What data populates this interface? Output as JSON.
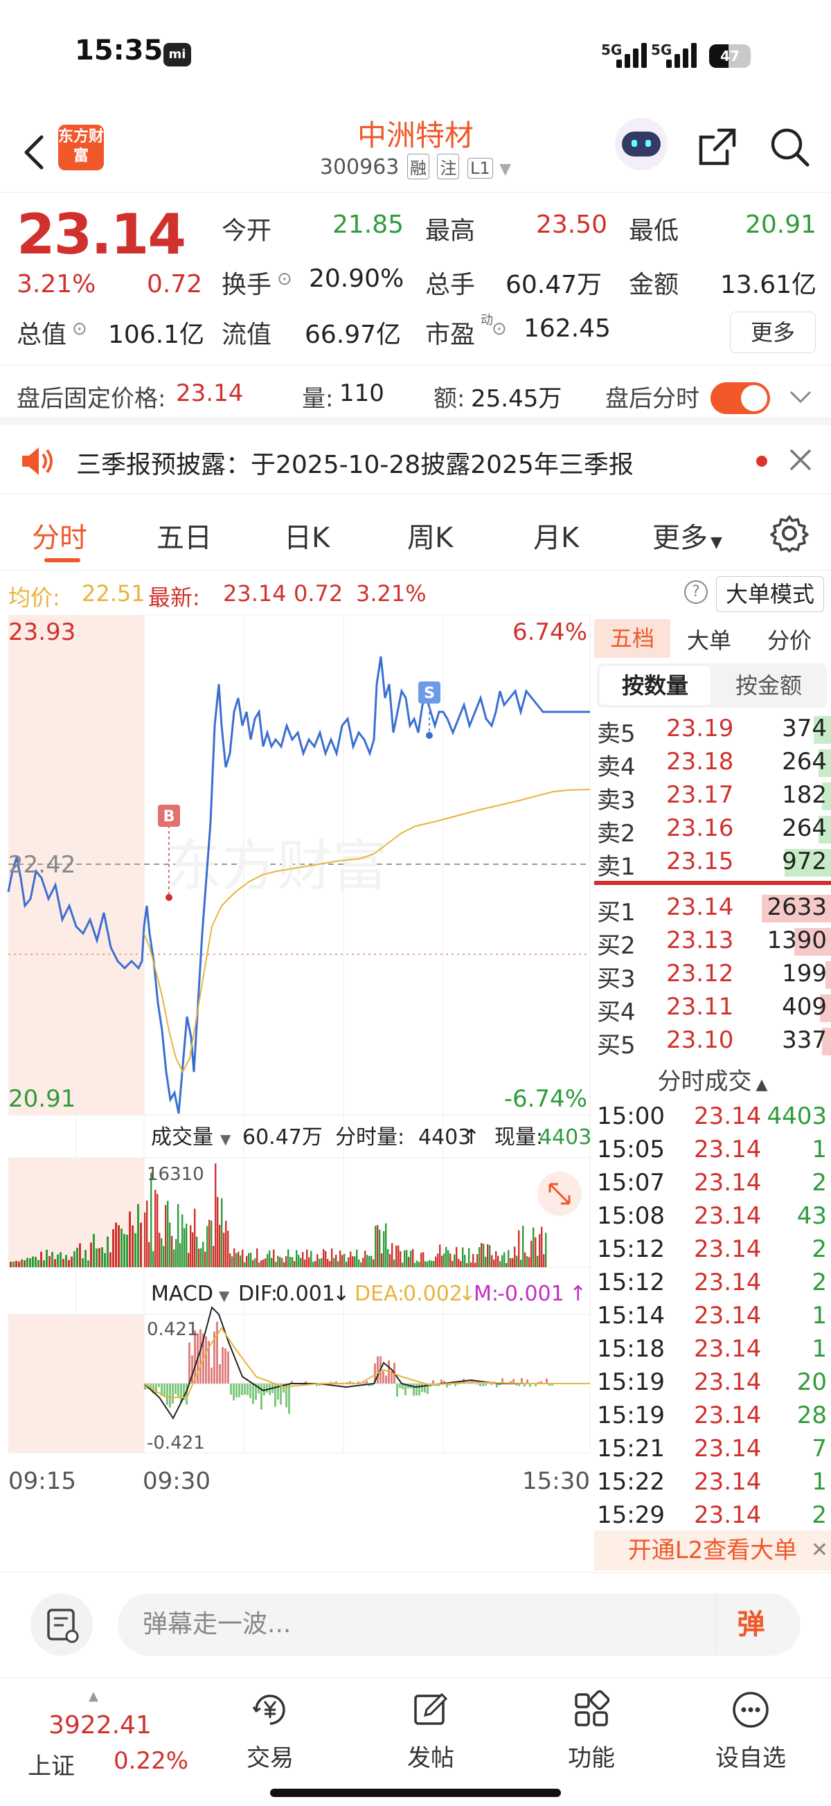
{
  "status_bar": {
    "time": "15:35",
    "signal1": "5G",
    "signal2": "5G",
    "battery": "47"
  },
  "header": {
    "logo": "东方财富",
    "stock_name": "中洲特材",
    "stock_code": "300963",
    "tags": [
      "融",
      "注",
      "L1"
    ]
  },
  "quote": {
    "price": "23.14",
    "pct": "3.21%",
    "change": "0.72",
    "fields": [
      {
        "label": "今开",
        "value": "21.85",
        "color": "#2e9c3a"
      },
      {
        "label": "最高",
        "value": "23.50",
        "color": "#d0312d"
      },
      {
        "label": "最低",
        "value": "20.91",
        "color": "#2e9c3a"
      },
      {
        "label": "换手",
        "value": "20.90%",
        "color": "#222222"
      },
      {
        "label": "总手",
        "value": "60.47万",
        "color": "#222222"
      },
      {
        "label": "金额",
        "value": "13.61亿",
        "color": "#222222"
      },
      {
        "label": "总值",
        "value": "106.1亿",
        "color": "#222222"
      },
      {
        "label": "流值",
        "value": "66.97亿",
        "color": "#222222"
      },
      {
        "label": "市盈",
        "value": "162.45",
        "color": "#222222"
      }
    ],
    "pe_sup": "动",
    "more_label": "更多"
  },
  "after_hours": {
    "fixed_label": "盘后固定价格:",
    "fixed_value": "23.14",
    "vol_label": "量:",
    "vol_value": "110",
    "amt_label": "额:",
    "amt_value": "25.45万",
    "timeshare_label": "盘后分时"
  },
  "notice": {
    "text": "三季报预披露：于2025-10-28披露2025年三季报"
  },
  "tabs": [
    "分时",
    "五日",
    "日K",
    "周K",
    "月K",
    "更多"
  ],
  "avg_row": {
    "avg_label": "均价:",
    "avg_value": "22.51",
    "latest_label": "最新:",
    "latest_value": "23.14",
    "change": "0.72",
    "pct": "3.21%",
    "mode_button": "大单模式"
  },
  "chart_labels": {
    "top_price": "23.93",
    "top_pct": "6.74%",
    "mid_price": "22.42",
    "bottom_price": "20.91",
    "bottom_pct": "-6.74%",
    "marker_b": "B",
    "marker_s": "S",
    "vol_title": "成交量",
    "vol_total": "60.47万",
    "timeshare_vol_label": "分时量:",
    "timeshare_vol": "4403",
    "now_vol_label": "现量:",
    "now_vol": "4403",
    "vol_max": "16310",
    "macd_title": "MACD",
    "dif_label": "DIF:",
    "dif": "0.001",
    "dea_label": "DEA:",
    "dea": "0.002",
    "m_label": "M:",
    "m": "-0.001",
    "macd_max": "0.421",
    "macd_min": "-0.421",
    "time_start": "09:15",
    "time_open": "09:30",
    "time_end": "15:30"
  },
  "chart_data": {
    "type": "line",
    "x_range": [
      "09:15",
      "15:30"
    ],
    "ylim": [
      20.91,
      23.93
    ],
    "pct_range": [
      "-6.74%",
      "6.74%"
    ],
    "reference": 22.42,
    "series": [
      {
        "name": "price",
        "x": [
          "09:15",
          "09:20",
          "09:25",
          "09:30",
          "09:32",
          "09:35",
          "09:40",
          "09:45",
          "09:50",
          "10:00",
          "10:30",
          "11:00",
          "11:30",
          "13:00",
          "13:05",
          "13:30",
          "14:00",
          "14:30",
          "15:00"
        ],
        "y": [
          22.42,
          22.25,
          22.1,
          22.0,
          21.3,
          21.0,
          21.5,
          22.6,
          23.3,
          23.0,
          22.9,
          22.95,
          23.0,
          23.55,
          23.2,
          23.15,
          23.2,
          23.14,
          23.14
        ]
      },
      {
        "name": "avg",
        "x": [
          "09:30",
          "09:40",
          "10:00",
          "10:30",
          "11:00",
          "11:30",
          "13:00",
          "13:30",
          "14:00",
          "14:30",
          "15:00"
        ],
        "y": [
          22.0,
          21.5,
          22.05,
          22.2,
          22.25,
          22.3,
          22.35,
          22.4,
          22.45,
          22.5,
          22.51
        ]
      }
    ],
    "volume": {
      "max": 16310,
      "total": "60.47万"
    },
    "macd": {
      "range": [
        -0.421,
        0.421
      ],
      "dif": 0.001,
      "dea": 0.002,
      "m": -0.001
    }
  },
  "order_book": {
    "tabs": [
      "五档",
      "大单",
      "分价"
    ],
    "seg": [
      "按数量",
      "按金额"
    ],
    "asks": [
      {
        "label": "卖5",
        "price": "23.19",
        "vol": "374",
        "ratio": 0.14
      },
      {
        "label": "卖4",
        "price": "23.18",
        "vol": "264",
        "ratio": 0.1
      },
      {
        "label": "卖3",
        "price": "23.17",
        "vol": "182",
        "ratio": 0.07
      },
      {
        "label": "卖2",
        "price": "23.16",
        "vol": "264",
        "ratio": 0.1
      },
      {
        "label": "卖1",
        "price": "23.15",
        "vol": "972",
        "ratio": 0.37
      }
    ],
    "bids": [
      {
        "label": "买1",
        "price": "23.14",
        "vol": "2633",
        "ratio": 1.0
      },
      {
        "label": "买2",
        "price": "23.13",
        "vol": "1390",
        "ratio": 0.53
      },
      {
        "label": "买3",
        "price": "23.12",
        "vol": "199",
        "ratio": 0.08
      },
      {
        "label": "买4",
        "price": "23.11",
        "vol": "409",
        "ratio": 0.16
      },
      {
        "label": "买5",
        "price": "23.10",
        "vol": "337",
        "ratio": 0.13
      }
    ],
    "ticks_title": "分时成交",
    "ticks": [
      {
        "time": "15:00",
        "price": "23.14",
        "vol": "4403"
      },
      {
        "time": "15:05",
        "price": "23.14",
        "vol": "1"
      },
      {
        "time": "15:07",
        "price": "23.14",
        "vol": "2"
      },
      {
        "time": "15:08",
        "price": "23.14",
        "vol": "43"
      },
      {
        "time": "15:12",
        "price": "23.14",
        "vol": "2"
      },
      {
        "time": "15:12",
        "price": "23.14",
        "vol": "2"
      },
      {
        "time": "15:14",
        "price": "23.14",
        "vol": "1"
      },
      {
        "time": "15:18",
        "price": "23.14",
        "vol": "1"
      },
      {
        "time": "15:19",
        "price": "23.14",
        "vol": "20"
      },
      {
        "time": "15:19",
        "price": "23.14",
        "vol": "28"
      },
      {
        "time": "15:21",
        "price": "23.14",
        "vol": "7"
      },
      {
        "time": "15:22",
        "price": "23.14",
        "vol": "1"
      },
      {
        "time": "15:29",
        "price": "23.14",
        "vol": "2"
      }
    ],
    "l2_banner": "开通L2查看大单"
  },
  "comment": {
    "placeholder": "弹幕走一波...",
    "danmu": "弹"
  },
  "bottom_nav": {
    "index_value": "3922.41",
    "index_name": "上证",
    "index_pct": "0.22%",
    "items": [
      "交易",
      "发帖",
      "功能",
      "设自选"
    ]
  },
  "colors": {
    "accent": "#f0582a",
    "up": "#d0312d",
    "down": "#2e9c3a",
    "price_line": "#3a6fd0",
    "avg_line": "#e8b43c"
  }
}
